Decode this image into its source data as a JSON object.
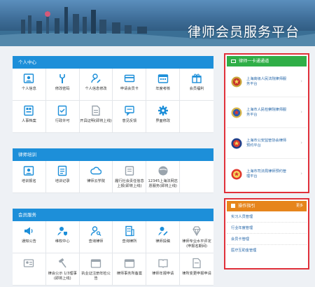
{
  "header": {
    "title": "律师会员服务平台"
  },
  "panels": [
    {
      "title": "个人中心",
      "items": [
        {
          "label": "个人信息",
          "icon": "person-card-icon"
        },
        {
          "label": "修改密码",
          "icon": "wrench-icon"
        },
        {
          "label": "个人信息修改",
          "icon": "person-edit-icon"
        },
        {
          "label": "申请会员卡",
          "icon": "card-icon"
        },
        {
          "label": "年度考核",
          "icon": "calendar-icon"
        },
        {
          "label": "会员福利",
          "icon": "gift-icon"
        },
        {
          "label": "人事档案",
          "icon": "file-grid-icon"
        },
        {
          "label": "行政许可",
          "icon": "license-icon"
        },
        {
          "label": "开具证明(即将上线)",
          "icon": "document-icon"
        },
        {
          "label": "意见反馈",
          "icon": "feedback-icon"
        },
        {
          "label": "界面修改",
          "icon": "gear-icon"
        },
        {
          "label": "",
          "icon": ""
        }
      ]
    },
    {
      "title": "律师培训",
      "items": [
        {
          "label": "培训报名",
          "icon": "person-card-icon"
        },
        {
          "label": "培训记录",
          "icon": "list-icon"
        },
        {
          "label": "律师云学院",
          "icon": "cloud-icon"
        },
        {
          "label": "履行社会责任信息上报(即将上线)",
          "icon": "report-icon"
        },
        {
          "label": "12345上海法网志愿服务(即将上线)",
          "icon": "globe-icon"
        },
        {
          "label": "",
          "icon": ""
        }
      ]
    },
    {
      "title": "会员服务",
      "items": [
        {
          "label": "通知公告",
          "icon": "speaker-icon"
        },
        {
          "label": "维权中心",
          "icon": "person-shield-icon"
        },
        {
          "label": "查询律师",
          "icon": "person-search-icon"
        },
        {
          "label": "查询律所",
          "icon": "building-icon"
        },
        {
          "label": "律师投稿",
          "icon": "person-pen-icon"
        },
        {
          "label": "律师专业水平评定(申报名期间)",
          "icon": "diamond-icon"
        },
        {
          "label": "",
          "icon": "person-id-icon"
        },
        {
          "label": "律会公示 1/3理事(即将上线)",
          "icon": "hammer-icon"
        },
        {
          "label": "执业证注册年检公告",
          "icon": "calendar-icon"
        },
        {
          "label": "律师事务所备案",
          "icon": "calendar-icon"
        },
        {
          "label": "律师年报申请",
          "icon": "book-icon"
        },
        {
          "label": "律所变更申报申请",
          "icon": "document-icon"
        }
      ]
    }
  ],
  "quick_channel": {
    "title": "律师一卡通通道",
    "items": [
      {
        "label": "上海高级人民法院律师服务平台",
        "icon": "court-emblem-icon"
      },
      {
        "label": "上海市人民检察院律师服务平台",
        "icon": "procuratorate-emblem-icon"
      },
      {
        "label": "上海市公安监管协会律师预约平台",
        "icon": "police-emblem-icon"
      },
      {
        "label": "上海市司法局律师预约管理平台",
        "icon": "justice-emblem-icon"
      }
    ]
  },
  "guide": {
    "title": "操作指引",
    "more": "更多",
    "items": [
      "实习人员管理",
      "行业年度管理",
      "会员卡管理",
      "医疗互助金管理"
    ]
  },
  "colors": {
    "accent": "#1d8fd9",
    "green": "#2fae47",
    "orange": "#e6851c",
    "highlight": "#e0303a"
  }
}
